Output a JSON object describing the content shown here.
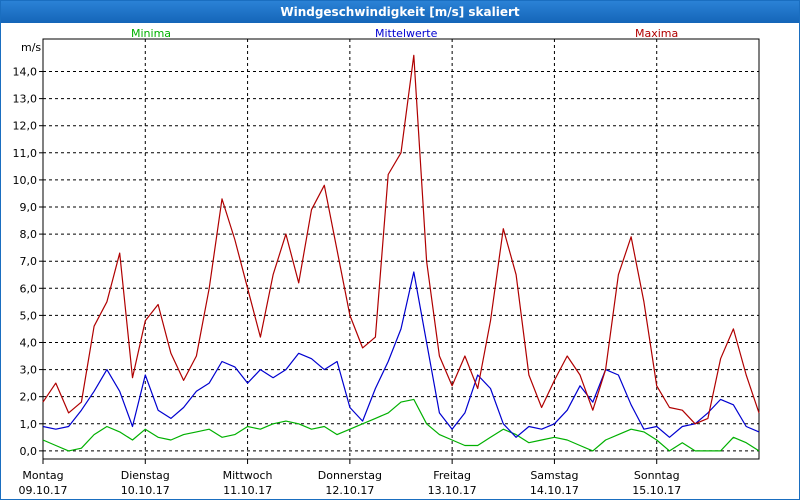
{
  "window": {
    "title": "Windgeschwindigkeit [m/s] skaliert"
  },
  "colors": {
    "minima": "#00b000",
    "mittelwerte": "#0000d0",
    "maxima": "#b00000",
    "grid": "#000000"
  },
  "chart_data": {
    "type": "line",
    "title": "Windgeschwindigkeit [m/s] skaliert",
    "ylabel": "m/s",
    "xlabel": "",
    "ylim": [
      -0.3,
      15.2
    ],
    "yticks": [
      "0,0",
      "1,0",
      "2,0",
      "3,0",
      "4,0",
      "5,0",
      "6,0",
      "7,0",
      "8,0",
      "9,0",
      "10,0",
      "11,0",
      "12,0",
      "13,0",
      "14,0"
    ],
    "grid": true,
    "legend": "top",
    "days": [
      {
        "name": "Montag",
        "date": "09.10.17"
      },
      {
        "name": "Dienstag",
        "date": "10.10.17"
      },
      {
        "name": "Mittwoch",
        "date": "11.10.17"
      },
      {
        "name": "Donnerstag",
        "date": "12.10.17"
      },
      {
        "name": "Freitag",
        "date": "13.10.17"
      },
      {
        "name": "Samstag",
        "date": "14.10.17"
      },
      {
        "name": "Sonntag",
        "date": "15.10.17"
      }
    ],
    "x_hours": [
      0,
      3,
      6,
      9,
      12,
      15,
      18,
      21,
      24,
      27,
      30,
      33,
      36,
      39,
      42,
      45,
      48,
      51,
      54,
      57,
      60,
      63,
      66,
      69,
      72,
      75,
      78,
      81,
      84,
      87,
      90,
      93,
      96,
      99,
      102,
      105,
      108,
      111,
      114,
      117,
      120,
      123,
      126,
      129,
      132,
      135,
      138,
      141,
      144,
      147,
      150,
      153,
      156,
      159,
      162,
      165,
      168
    ],
    "series": [
      {
        "name": "Minima",
        "values": [
          0.4,
          0.2,
          0.0,
          0.1,
          0.6,
          0.9,
          0.7,
          0.4,
          0.8,
          0.5,
          0.4,
          0.6,
          0.7,
          0.8,
          0.5,
          0.6,
          0.9,
          0.8,
          1.0,
          1.1,
          1.0,
          0.8,
          0.9,
          0.6,
          0.8,
          1.0,
          1.2,
          1.4,
          1.8,
          1.9,
          1.0,
          0.6,
          0.4,
          0.2,
          0.2,
          0.5,
          0.8,
          0.6,
          0.3,
          0.4,
          0.5,
          0.4,
          0.2,
          0.0,
          0.4,
          0.6,
          0.8,
          0.7,
          0.4,
          0.0,
          0.3,
          0.0,
          0.0,
          0.0,
          0.5,
          0.3,
          0.0
        ]
      },
      {
        "name": "Mittelwerte",
        "values": [
          0.9,
          0.8,
          0.9,
          1.5,
          2.2,
          3.0,
          2.2,
          0.9,
          2.8,
          1.5,
          1.2,
          1.6,
          2.2,
          2.5,
          3.3,
          3.1,
          2.5,
          3.0,
          2.7,
          3.0,
          3.6,
          3.4,
          3.0,
          3.3,
          1.6,
          1.1,
          2.3,
          3.3,
          4.5,
          6.6,
          4.0,
          1.4,
          0.8,
          1.4,
          2.8,
          2.3,
          1.0,
          0.5,
          0.9,
          0.8,
          1.0,
          1.5,
          2.4,
          1.8,
          3.0,
          2.8,
          1.7,
          0.8,
          0.9,
          0.5,
          0.9,
          1.0,
          1.4,
          1.9,
          1.7,
          0.9,
          0.7
        ]
      },
      {
        "name": "Maxima",
        "values": [
          1.8,
          2.5,
          1.4,
          1.8,
          4.6,
          5.5,
          7.3,
          2.7,
          4.8,
          5.4,
          3.6,
          2.6,
          3.5,
          6.0,
          9.3,
          7.8,
          6.0,
          4.2,
          6.5,
          8.0,
          6.2,
          8.9,
          9.8,
          7.4,
          5.0,
          3.8,
          4.2,
          10.2,
          11.0,
          14.6,
          7.0,
          3.5,
          2.4,
          3.5,
          2.3,
          4.8,
          8.2,
          6.5,
          2.8,
          1.6,
          2.6,
          3.5,
          2.8,
          1.5,
          3.0,
          6.5,
          7.9,
          5.5,
          2.4,
          1.6,
          1.5,
          1.0,
          1.2,
          3.4,
          4.5,
          2.8,
          1.4
        ]
      }
    ]
  }
}
